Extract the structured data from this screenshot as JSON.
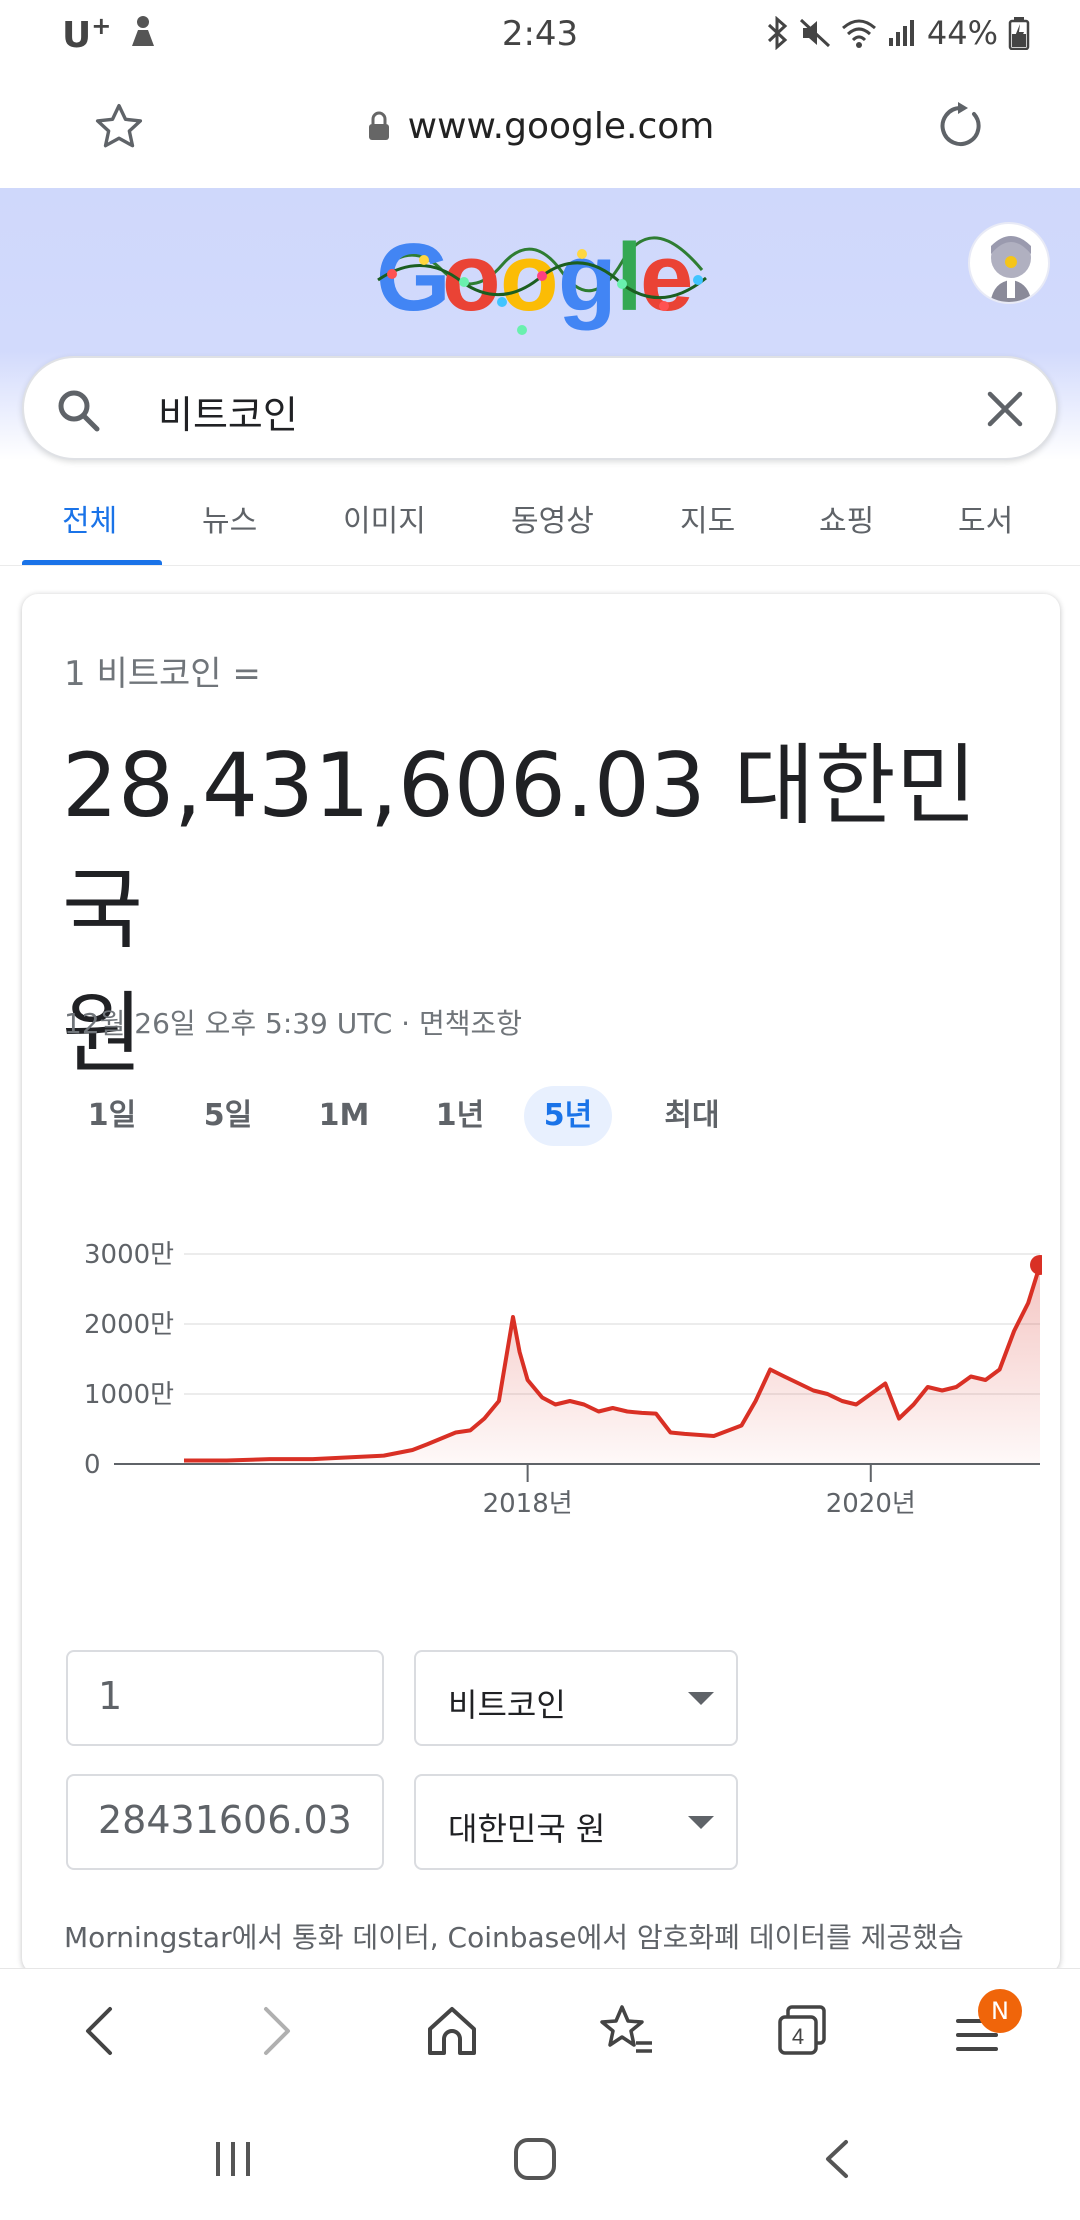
{
  "status_bar": {
    "carrier": "U",
    "carrier_sup": "+",
    "time": "2:43",
    "battery": "44%"
  },
  "address_bar": {
    "url": "www.google.com"
  },
  "search": {
    "query": "비트코인"
  },
  "tabs": [
    {
      "label": "전체",
      "active": true
    },
    {
      "label": "뉴스"
    },
    {
      "label": "이미지"
    },
    {
      "label": "동영상"
    },
    {
      "label": "지도"
    },
    {
      "label": "쇼핑"
    },
    {
      "label": "도서"
    }
  ],
  "converter": {
    "from_text": "1 비트코인 =",
    "result_line1": "28,431,606.03 대한민국",
    "result_line2": "원",
    "timestamp": "12월 26일 오후 5:39 UTC · 면책조항",
    "periods": [
      "1일",
      "5일",
      "1M",
      "1년",
      "5년",
      "최대"
    ],
    "active_period": "5년",
    "amount_value": "1",
    "from_currency": "비트코인",
    "result_value": "28431606.03",
    "to_currency": "대한민국 원",
    "source_text": "Morningstar에서 통화 데이터, Coinbase에서 암호화폐 데이터를 제공했습"
  },
  "chart_data": {
    "type": "area",
    "x_tick_labels": [
      "2018년",
      "2020년"
    ],
    "y_tick_labels": [
      "3000만",
      "2000만",
      "1000만",
      "0"
    ],
    "ylim": [
      0,
      30000000
    ],
    "grid": true,
    "line_color": "#d93025",
    "x": [
      "2016-01",
      "2016-04",
      "2016-07",
      "2016-10",
      "2017-01",
      "2017-03",
      "2017-05",
      "2017-06",
      "2017-08",
      "2017-09",
      "2017-10",
      "2017-11",
      "2017-12",
      "2017-12-15",
      "2018-01",
      "2018-02",
      "2018-03",
      "2018-04",
      "2018-05",
      "2018-06",
      "2018-07",
      "2018-08",
      "2018-09",
      "2018-10",
      "2018-11",
      "2018-12",
      "2019-02",
      "2019-04",
      "2019-05",
      "2019-06",
      "2019-07",
      "2019-08",
      "2019-09",
      "2019-10",
      "2019-11",
      "2019-12",
      "2020-01",
      "2020-02",
      "2020-03",
      "2020-04",
      "2020-05",
      "2020-06",
      "2020-07",
      "2020-08",
      "2020-09",
      "2020-10",
      "2020-11",
      "2020-12",
      "2020-12-26"
    ],
    "values": [
      500000,
      500000,
      700000,
      700000,
      1000000,
      1200000,
      2000000,
      2800000,
      4500000,
      4800000,
      6500000,
      9000000,
      21000000,
      16000000,
      12000000,
      9500000,
      8500000,
      9000000,
      8500000,
      7500000,
      8000000,
      7500000,
      7300000,
      7200000,
      4500000,
      4300000,
      4000000,
      5500000,
      9000000,
      13500000,
      12500000,
      11500000,
      10500000,
      10000000,
      9000000,
      8500000,
      10000000,
      11500000,
      6500000,
      8500000,
      11000000,
      10500000,
      11000000,
      12500000,
      12000000,
      13500000,
      19000000,
      23000000,
      28431606
    ]
  },
  "bottom_bar": {
    "tab_count": "4",
    "badge": "N"
  }
}
